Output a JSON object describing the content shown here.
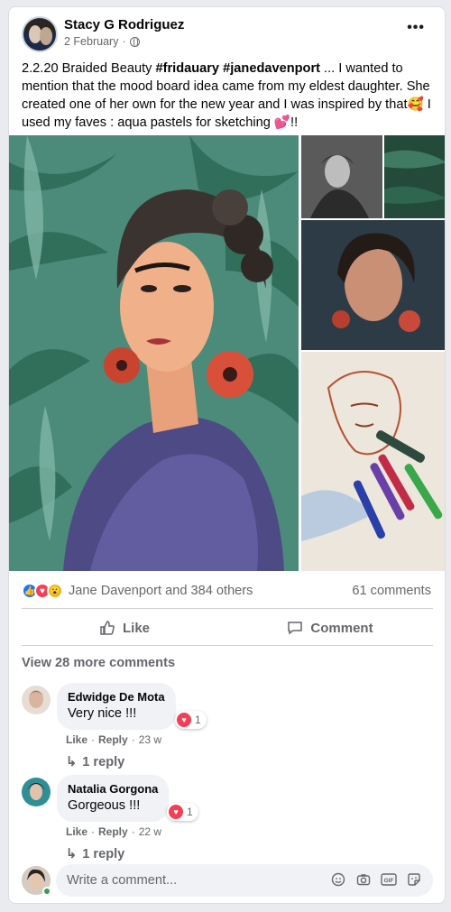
{
  "post": {
    "author": "Stacy G Rodriguez",
    "date": "2 February",
    "separator": "·",
    "more_label": "•••",
    "text_prefix": "2.2.20 Braided Beauty ",
    "hashtag1": "#fridauary",
    "space": " ",
    "hashtag2": "#janedavenport",
    "text_body": " ... I wanted to mention that the mood board idea came from my eldest daughter. She created one of her own for the new year and I was inspired by that🥰  I used my faves : aqua pastels for sketching 💕!!"
  },
  "reactions": {
    "summary": "Jane Davenport and 384 others",
    "comments": "61 comments",
    "icons": [
      "like-icon",
      "love-icon",
      "wow-icon"
    ]
  },
  "actions": {
    "like": "Like",
    "comment": "Comment"
  },
  "view_more": "View 28 more comments",
  "comments": [
    {
      "name": "Edwidge De Mota",
      "text": "Very nice !!!",
      "reaction_count": "1",
      "like": "Like",
      "reply": "Reply",
      "time": "23 w",
      "dot": "·",
      "replies": "1 reply"
    },
    {
      "name": "Natalia Gorgona",
      "text": "Gorgeous !!!",
      "reaction_count": "1",
      "like": "Like",
      "reply": "Reply",
      "time": "22 w",
      "dot": "·",
      "replies": "1 reply"
    }
  ],
  "write": {
    "placeholder": "Write a comment..."
  },
  "colors": {
    "brand_blue": "#1877f2",
    "love_red": "#f33e58",
    "wow_yellow": "#f7b125",
    "online_green": "#31a24c"
  }
}
